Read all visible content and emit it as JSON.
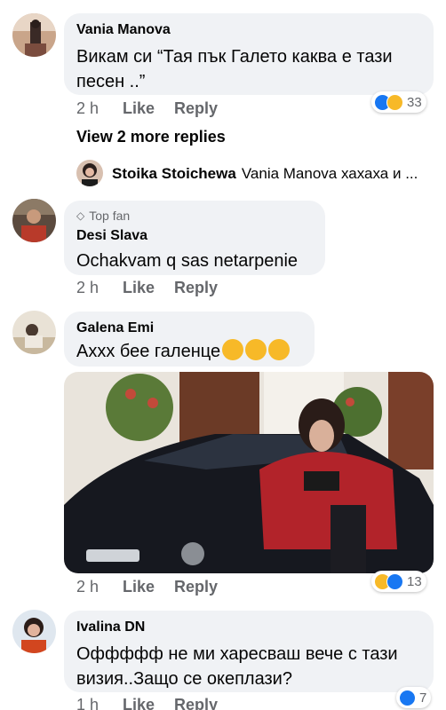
{
  "comments": [
    {
      "author": "Vania Manova",
      "text_line1": "Викам си “Тая пък Галето каква е тази",
      "text_line2": "песен ..”",
      "time": "2 h",
      "like": "Like",
      "reply": "Reply",
      "reaction_count": "33"
    },
    {
      "badge": "Top fan",
      "author": "Desi Slava",
      "text": "Ochakvam q sas netarpenie",
      "time": "2 h",
      "like": "Like",
      "reply": "Reply"
    },
    {
      "author": "Galena Emi",
      "text": "Аххх бее галенце",
      "time": "2 h",
      "like": "Like",
      "reply": "Reply",
      "reaction_count": "13"
    },
    {
      "author": "Ivalina DN",
      "text_line1": "Оффффф не ми харесваш вече с тази",
      "text_line2": "визия..Защо се океплази?",
      "time": "1 h",
      "like": "Like",
      "reply": "Reply",
      "reaction_count": "7"
    }
  ],
  "view_more": "View 2 more replies",
  "reply_preview": {
    "author": "Stoika Stoichewa",
    "text": "Vania Manova  хахаха и ..."
  },
  "colors": {
    "bubble": "#f0f2f5",
    "meta": "#65676b",
    "like_blue": "#1877f2",
    "haha_yellow": "#f7b928"
  },
  "icons": [
    "diamond-icon",
    "like-reaction-icon",
    "haha-reaction-icon",
    "laughing-emoji-icon"
  ]
}
